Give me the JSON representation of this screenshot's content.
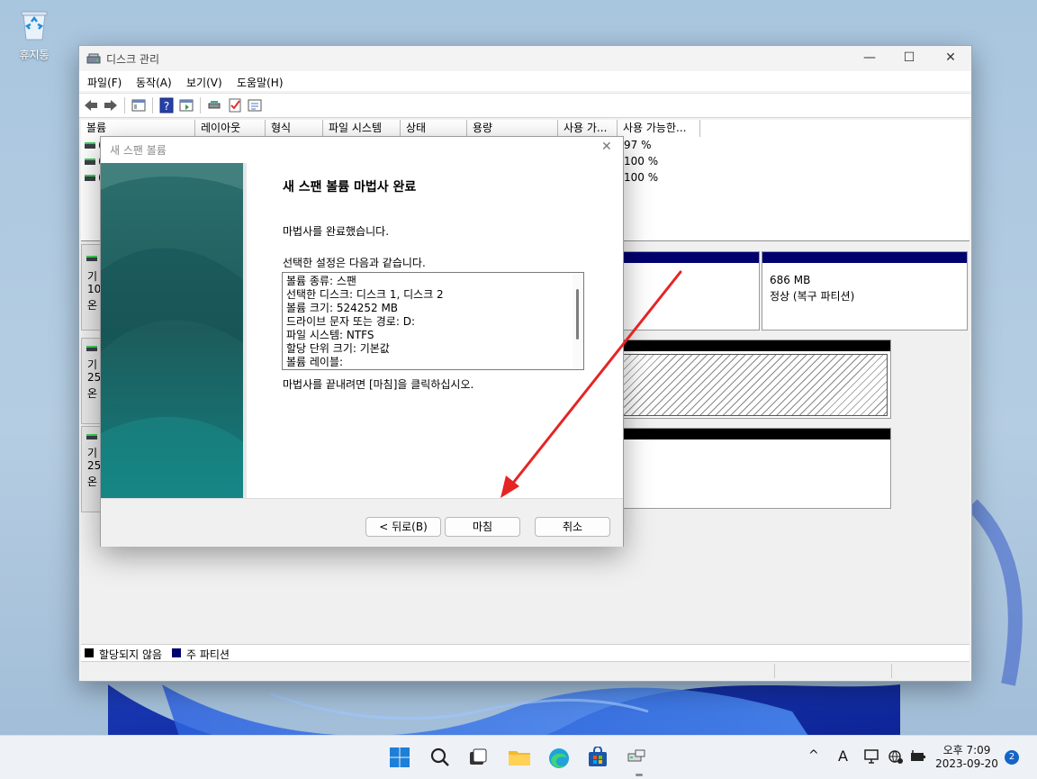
{
  "desktop": {
    "recycle_bin_label": "휴지통"
  },
  "window": {
    "title": "디스크 관리",
    "controls": {
      "minimize": "—",
      "maximize": "☐",
      "close": "✕"
    },
    "menu": [
      "파일(F)",
      "동작(A)",
      "보기(V)",
      "도움말(H)"
    ],
    "columns": [
      "볼륨",
      "레이아웃",
      "형식",
      "파일 시스템",
      "상태",
      "용량",
      "사용 가...",
      "사용 가능한..."
    ],
    "volume_rows": [
      {
        "prefix": "(",
        "free_pct": "97 %"
      },
      {
        "prefix": "(",
        "free_pct": "100 %"
      },
      {
        "prefix": "(",
        "free_pct": "100 %"
      }
    ],
    "disks": [
      {
        "l1": "기",
        "l2": "10",
        "l3": "온"
      },
      {
        "l1": "기",
        "l2": "25",
        "l3": "온"
      },
      {
        "l1": "기",
        "l2": "25",
        "l3": "온"
      }
    ],
    "recovery_partition": {
      "size": "686 MB",
      "status": "정상 (복구 파티션)"
    },
    "legend": {
      "unallocated": "할당되지 않음",
      "primary": "주 파티션"
    },
    "colors": {
      "unallocated": "#000000",
      "primary": "#00006e"
    }
  },
  "dialog": {
    "title": "새 스팬 볼륨",
    "heading": "새 스팬 볼륨 마법사 완료",
    "completed_text": "마법사를 완료했습니다.",
    "settings_intro": "선택한 설정은 다음과 같습니다.",
    "summary_lines": [
      "볼륨 종류: 스팬",
      "선택한 디스크: 디스크 1, 디스크 2",
      "볼륨 크기: 524252 MB",
      "드라이브 문자 또는 경로: D:",
      "파일 시스템: NTFS",
      "할당 단위 크기: 기본값",
      "볼륨 레이블:"
    ],
    "finish_hint": "마법사를 끝내려면 [마침]을 클릭하십시오.",
    "buttons": {
      "back": "< 뒤로(B)",
      "finish": "마침",
      "cancel": "취소"
    }
  },
  "taskbar": {
    "time": "오후 7:09",
    "date": "2023-09-20",
    "ime": "A",
    "chevron": "^",
    "notification_count": "2"
  }
}
